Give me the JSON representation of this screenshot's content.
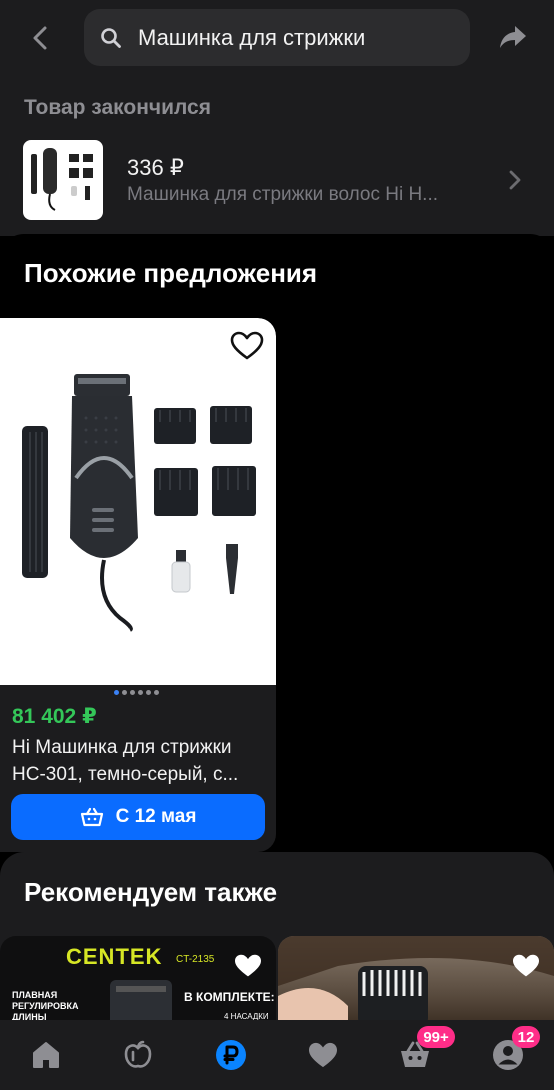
{
  "header": {
    "search_value": "Машинка для стрижки"
  },
  "out_of_stock": {
    "title": "Товар закончился",
    "price": "336 ₽",
    "name": "Машинка для стрижки волос Hi H..."
  },
  "similar": {
    "title": "Похожие предложения",
    "card": {
      "price": "81 402 ₽",
      "title": "Hi Машинка для стрижки HC-301, темно-серый, с...",
      "button_label": "С 12 мая",
      "image_count": 6,
      "active_image": 0
    }
  },
  "recommend": {
    "title": "Рекомендуем также",
    "card1": {
      "brand": "CENTEK",
      "model": "CT-2135",
      "desc": "ПЛАВНАЯ РЕГУЛИРОВКА ДЛИНЫ",
      "kit": "В КОМПЛЕКТЕ:",
      "kit_sub": "4 НАСАДКИ"
    }
  },
  "bottom_nav": {
    "items": [
      {
        "icon": "home-icon"
      },
      {
        "icon": "catalog-icon"
      },
      {
        "icon": "ruble-icon"
      },
      {
        "icon": "heart-icon"
      },
      {
        "icon": "basket-icon",
        "badge": "99+"
      },
      {
        "icon": "profile-icon",
        "badge": "12"
      }
    ],
    "active_index": 2
  },
  "colors": {
    "accent_blue": "#0a6cff",
    "price_green": "#34c759",
    "badge_pink": "#ff2d88",
    "background": "#000000",
    "surface": "#1c1c1e"
  }
}
